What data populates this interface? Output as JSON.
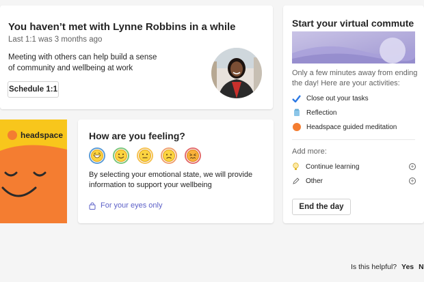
{
  "oneonone": {
    "title": "You haven’t met with Lynne Robbins in a while",
    "subtitle": "Last 1:1 was 3 months ago",
    "body": "Meeting with others can help build a sense of community and wellbeing at work",
    "button": "Schedule 1:1",
    "avatar_icon": "person-photo"
  },
  "commute": {
    "title": "Start your virtual commute",
    "description": "Only a few minutes away from ending the day! Here are your activities:",
    "activities": [
      {
        "label": "Close out your tasks",
        "icon": "checkmark-icon",
        "color": "#2b78e4"
      },
      {
        "label": "Reflection",
        "icon": "reflection-icon",
        "color": "#8cc6e8"
      },
      {
        "label": "Headspace guided meditation",
        "icon": "headspace-dot-icon",
        "color": "#f47d31"
      }
    ],
    "add_more_label": "Add more:",
    "add_more": [
      {
        "label": "Continue learning",
        "icon": "lightbulb-icon"
      },
      {
        "label": "Other",
        "icon": "pencil-icon"
      }
    ],
    "button": "End the day"
  },
  "headspace": {
    "logo_text": "headspace",
    "color": "#f47d31",
    "header_color": "#f8c61c"
  },
  "feeling": {
    "title": "How are you feeling?",
    "emojis": [
      "grinning-face-icon",
      "smiling-face-icon",
      "neutral-face-icon",
      "worried-face-icon",
      "angry-face-icon"
    ],
    "body": "By selecting your emotional state, we will provide information to support your wellbeing",
    "privacy": "For your eyes only"
  },
  "footer": {
    "question": "Is this helpful?",
    "yes": "Yes",
    "no": "No"
  },
  "colors": {
    "accent": "#5b5fc7",
    "background": "#f5f5f5"
  }
}
